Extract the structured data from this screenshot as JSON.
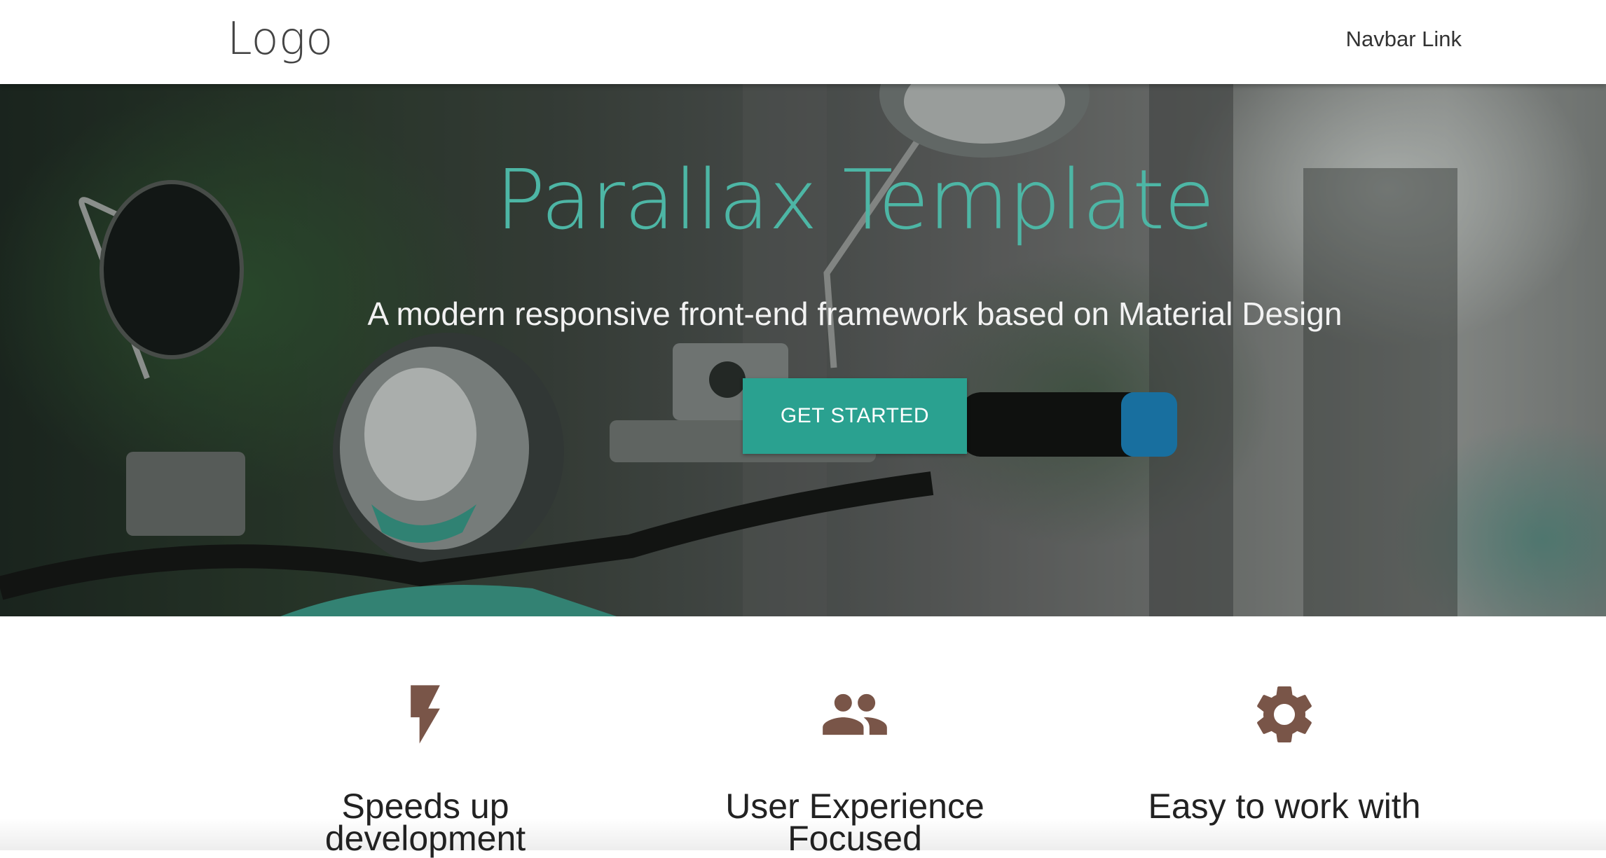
{
  "navbar": {
    "logo": "Logo",
    "link": "Navbar Link"
  },
  "hero": {
    "title": "Parallax Template",
    "subtitle": "A modern responsive front-end framework based on Material Design",
    "cta_label": "GET STARTED",
    "background_image": "motor-scooter-handlebar-photo"
  },
  "features": [
    {
      "icon": "flash-icon",
      "title": "Speeds up development"
    },
    {
      "icon": "group-icon",
      "title": "User Experience Focused"
    },
    {
      "icon": "settings-icon",
      "title": "Easy to work with"
    }
  ],
  "colors": {
    "accent": "#4db6a5",
    "button": "#2aa190",
    "icon": "#795548"
  }
}
